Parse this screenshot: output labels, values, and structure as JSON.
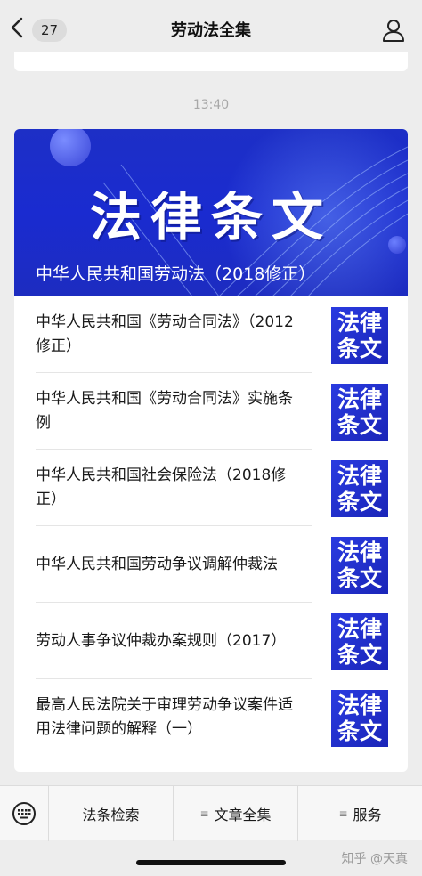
{
  "nav": {
    "back_count": "27",
    "title": "劳动法全集"
  },
  "timestamp": "13:40",
  "banner": {
    "big_text": "法律条文",
    "subtitle": "中华人民共和国劳动法（2018修正）"
  },
  "thumb": {
    "line1": "法律",
    "line2": "条文"
  },
  "articles": [
    {
      "title": "中华人民共和国《劳动合同法》（2012修正）"
    },
    {
      "title": "中华人民共和国《劳动合同法》实施条例"
    },
    {
      "title": "中华人民共和国社会保险法（2018修正）"
    },
    {
      "title": "中华人民共和国劳动争议调解仲裁法"
    },
    {
      "title": "劳动人事争议仲裁办案规则（2017）"
    },
    {
      "title": "最高人民法院关于审理劳动争议案件适用法律问题的解释（一）"
    }
  ],
  "tabbar": {
    "tab1": "法条检索",
    "tab2": "文章全集",
    "tab3": "服务"
  },
  "watermark": "知乎 @天真",
  "colors": {
    "accent_blue": "#1d2fc6",
    "background": "#ededed"
  }
}
